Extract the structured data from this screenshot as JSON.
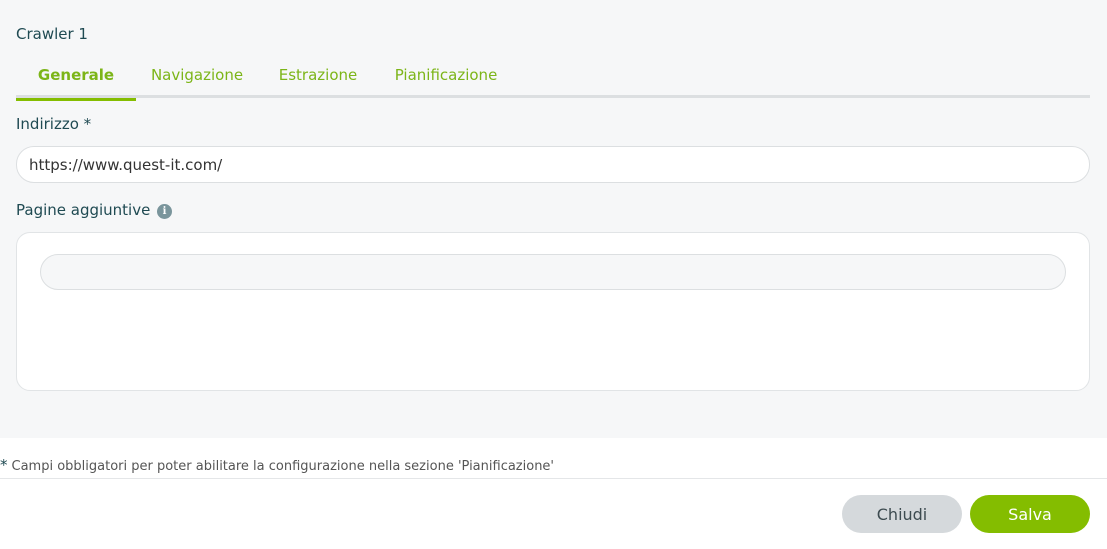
{
  "header": {
    "title": "Crawler 1"
  },
  "tabs": [
    {
      "label": "Generale",
      "active": true
    },
    {
      "label": "Navigazione",
      "active": false
    },
    {
      "label": "Estrazione",
      "active": false
    },
    {
      "label": "Pianificazione",
      "active": false
    }
  ],
  "address": {
    "label": "Indirizzo *",
    "value": "https://www.quest-it.com/"
  },
  "additional_pages": {
    "label": "Pagine aggiuntive",
    "info_icon": "info-icon",
    "value": ""
  },
  "footnote": {
    "star": "*",
    "text": "Campi obbligatori per poter abilitare la configurazione nella sezione 'Pianificazione'"
  },
  "buttons": {
    "close_label": "Chiudi",
    "save_label": "Salva"
  },
  "colors": {
    "accent": "#84bd00",
    "heading": "#1f4a52",
    "close_button": "#d5d9dc"
  }
}
